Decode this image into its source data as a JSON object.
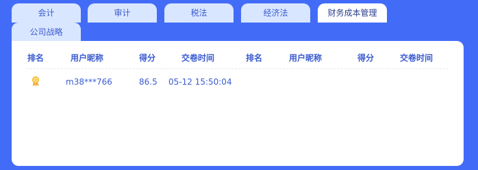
{
  "tabs": [
    {
      "label": "会计",
      "active": false
    },
    {
      "label": "审计",
      "active": false
    },
    {
      "label": "税法",
      "active": false
    },
    {
      "label": "经济法",
      "active": false
    },
    {
      "label": "财务成本管理",
      "active": true
    },
    {
      "label": "公司战略",
      "active": false
    }
  ],
  "table": {
    "headers": [
      "排名",
      "用户昵称",
      "得分",
      "交卷时间",
      "排名",
      "用户昵称",
      "得分",
      "交卷时间"
    ],
    "rows": [
      {
        "rank_icon": "medal-icon",
        "nickname": "m38***766",
        "score": "86.5",
        "submit_time": "05-12 15:50:04"
      }
    ]
  },
  "colors": {
    "background": "#426cf8",
    "tab_inactive": "#d9e6ff",
    "tab_active": "#ffffff",
    "text": "#3a5bd0",
    "medal": "#f5c244"
  }
}
